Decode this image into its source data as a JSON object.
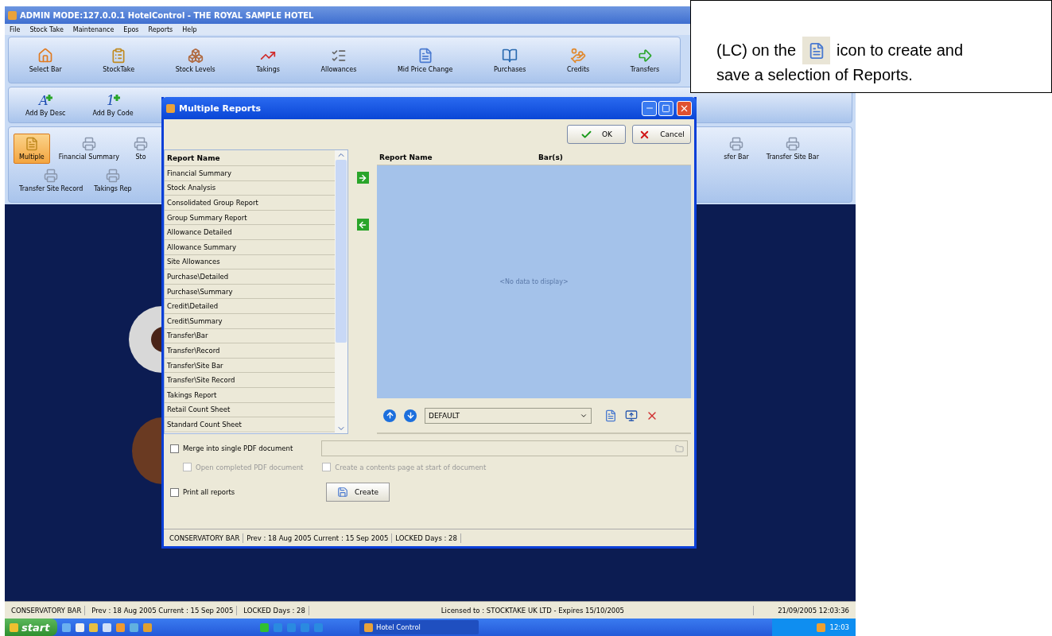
{
  "window": {
    "title": "ADMIN MODE:127.0.0.1 HotelControl - THE ROYAL SAMPLE HOTEL"
  },
  "menu": [
    "File",
    "Stock Take",
    "Maintenance",
    "Epos",
    "Reports",
    "Help"
  ],
  "main_toolbar": [
    {
      "label": "Select Bar",
      "kind": "house"
    },
    {
      "label": "StockTake",
      "kind": "stocktake"
    },
    {
      "label": "Stock Levels",
      "kind": "levels"
    },
    {
      "label": "Takings",
      "kind": "takings"
    },
    {
      "label": "Allowances",
      "kind": "allowances"
    },
    {
      "label": "Mid Price Change",
      "kind": "price"
    },
    {
      "label": "Purchases",
      "kind": "purchases"
    },
    {
      "label": "Credits",
      "kind": "credits"
    },
    {
      "label": "Transfers",
      "kind": "transfers"
    }
  ],
  "add_toolbar": [
    {
      "label": "Add By Desc",
      "glyph": "A"
    },
    {
      "label": "Add By Code",
      "glyph": "1"
    }
  ],
  "reports_ribbon": {
    "row_1_left": [
      {
        "label": "Multiple",
        "kind": "document",
        "selected": true
      },
      {
        "label": "Financial Summary",
        "kind": "printer",
        "selected": false
      },
      {
        "label": "Sto",
        "kind": "printer",
        "selected": false
      }
    ],
    "row_1_right": [
      {
        "label": "sfer Bar",
        "kind": "printer",
        "selected": false
      },
      {
        "label": "Transfer Site Bar",
        "kind": "printer",
        "selected": false
      }
    ],
    "row_2": [
      {
        "label": "Transfer Site Record",
        "kind": "printer",
        "selected": false
      },
      {
        "label": "Takings Rep",
        "kind": "printer",
        "selected": false
      }
    ]
  },
  "status_bar": {
    "bar": "CONSERVATORY BAR",
    "dates": "Prev : 18 Aug 2005  Current : 15 Sep 2005",
    "locked": "LOCKED Days : 28",
    "license": "Licensed to : STOCKTAKE UK LTD - Expires 15/10/2005",
    "datetime": "21/09/2005 12:03:36"
  },
  "taskbar": {
    "start": "start",
    "task": "Hotel Control",
    "clock": "12:03"
  },
  "dialog": {
    "title": "Multiple Reports",
    "ok": "OK",
    "cancel": "Cancel",
    "available": {
      "header": "Report Name",
      "rows": [
        "Financial Summary",
        "Stock Analysis",
        "Consolidated Group Report",
        "Group Summary Report",
        "Allowance Detailed",
        "Allowance Summary",
        "Site Allowances",
        "Purchase\\Detailed",
        "Purchase\\Summary",
        "Credit\\Detailed",
        "Credit\\Summary",
        "Transfer\\Bar",
        "Transfer\\Record",
        "Transfer\\Site Bar",
        "Transfer\\Site Record",
        "Takings Report",
        "Retail Count Sheet",
        "Standard Count Sheet"
      ]
    },
    "selected_reports": {
      "columns": [
        "Report Name",
        "Bar(s)"
      ],
      "empty": "<No data to display>"
    },
    "preset": "DEFAULT",
    "merge": {
      "label": "Merge into single PDF document",
      "checked": false
    },
    "open_pdf": {
      "label": "Open completed PDF document",
      "checked": false,
      "disabled": true
    },
    "contents_page": {
      "label": "Create a contents page at start of document",
      "checked": false,
      "disabled": true
    },
    "print_all": {
      "label": "Print all reports",
      "checked": false
    },
    "create": "Create",
    "status": {
      "bar": "CONSERVATORY BAR",
      "dates": "Prev : 18 Aug 2005  Current : 15 Sep 2005",
      "locked": "LOCKED Days : 28"
    }
  },
  "callout": {
    "lead": "(LC) on the",
    "trail": "icon to create and",
    "line_2": "save a selection of Reports."
  }
}
